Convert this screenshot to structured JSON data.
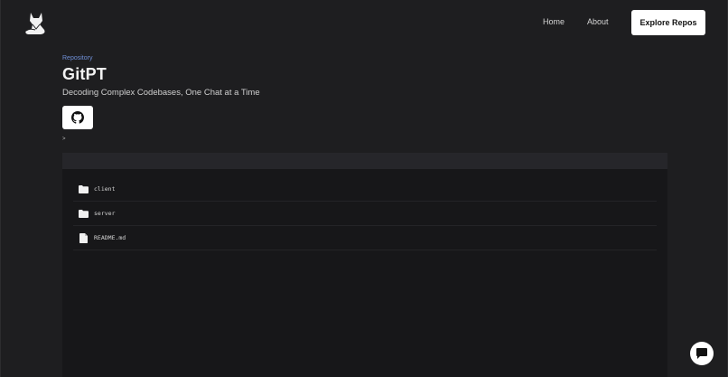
{
  "header": {
    "logo_icon": "fox-logo-icon",
    "nav": [
      {
        "label": "Home"
      },
      {
        "label": "About"
      }
    ],
    "cta_label": "Explore Repos"
  },
  "repo": {
    "kicker": "Repository",
    "title": "GitPT",
    "subtitle": "Decoding Complex Codebases, One Chat at a Time",
    "github_icon": "github-icon",
    "breadcrumb": ">"
  },
  "files": [
    {
      "name": "client",
      "type": "folder",
      "icon": "folder-icon"
    },
    {
      "name": "server",
      "type": "folder",
      "icon": "folder-icon"
    },
    {
      "name": "README.md",
      "type": "file",
      "icon": "file-icon"
    }
  ],
  "chat_fab": {
    "icon": "chat-bubble-icon"
  },
  "colors": {
    "background": "#1e1e20",
    "panel": "#171719",
    "accent_link": "#6f8fd6",
    "button_bg": "#ffffff"
  }
}
